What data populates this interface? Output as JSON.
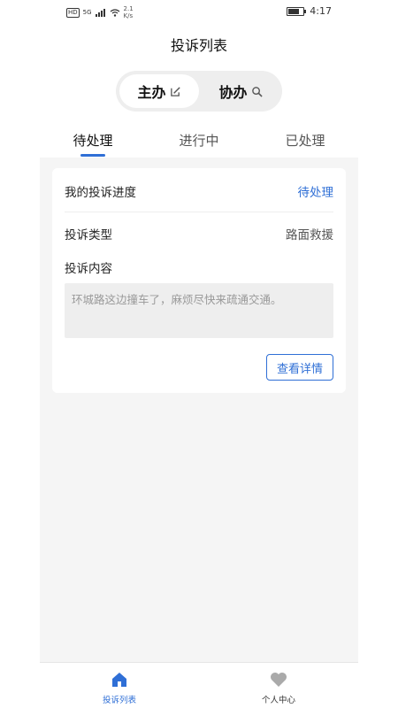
{
  "statusbar": {
    "hd": "HD",
    "network": "5G",
    "speed_value": "2.1",
    "speed_unit": "K/s",
    "time": "4:17",
    "battery_level": 0.85
  },
  "header": {
    "title": "投诉列表"
  },
  "segment": {
    "items": [
      {
        "label": "主办",
        "icon": "edit-icon",
        "active": true
      },
      {
        "label": "协办",
        "icon": "search-icon",
        "active": false
      }
    ]
  },
  "tabs": [
    {
      "label": "待处理",
      "active": true
    },
    {
      "label": "进行中",
      "active": false
    },
    {
      "label": "已处理",
      "active": false
    }
  ],
  "card": {
    "progress_label": "我的投诉进度",
    "progress_value": "待处理",
    "type_label": "投诉类型",
    "type_value": "路面救援",
    "content_label": "投诉内容",
    "content_text": "环城路这边撞车了，麻烦尽快来疏通交通。",
    "detail_button": "查看详情"
  },
  "bottom_nav": [
    {
      "label": "投诉列表",
      "icon": "home-icon",
      "active": true
    },
    {
      "label": "个人中心",
      "icon": "heart-icon",
      "active": false
    }
  ],
  "colors": {
    "accent": "#2f6fd6",
    "background": "#f5f5f5"
  }
}
